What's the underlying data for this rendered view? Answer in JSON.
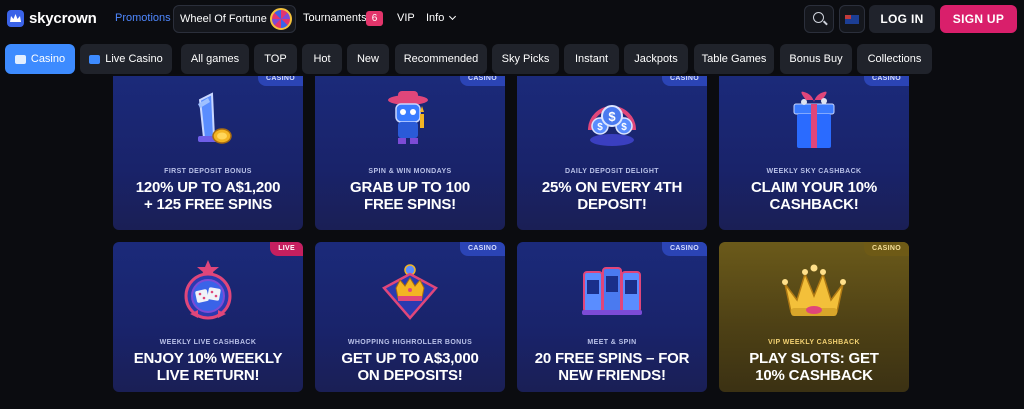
{
  "header": {
    "logo_text": "skycrown",
    "nav": {
      "promotions": "Promotions",
      "wheel_of_fortune": "Wheel Of Fortune",
      "tournaments": "Tournaments",
      "tournaments_count": "6",
      "vip": "VIP",
      "info": "Info"
    },
    "login_label": "LOG IN",
    "signup_label": "SIGN UP"
  },
  "categories": [
    {
      "label": "Casino",
      "active": true
    },
    {
      "label": "Live Casino"
    },
    {
      "label": "All games"
    },
    {
      "label": "TOP"
    },
    {
      "label": "Hot"
    },
    {
      "label": "New"
    },
    {
      "label": "Recommended"
    },
    {
      "label": "Sky Picks"
    },
    {
      "label": "Instant"
    },
    {
      "label": "Jackpots"
    },
    {
      "label": "Table Games"
    },
    {
      "label": "Bonus Buy"
    },
    {
      "label": "Collections"
    }
  ],
  "promos": [
    {
      "badge": "CASINO",
      "sub": "FIRST DEPOSIT BONUS",
      "head1": "120% UP TO A$1,200",
      "head2": "+ 125 FREE SPINS"
    },
    {
      "badge": "CASINO",
      "sub": "SPIN & WIN MONDAYS",
      "head1": "GRAB UP TO 100",
      "head2": "FREE SPINS!"
    },
    {
      "badge": "CASINO",
      "sub": "DAILY DEPOSIT DELIGHT",
      "head1": "25% ON EVERY 4TH",
      "head2": "DEPOSIT!"
    },
    {
      "badge": "CASINO",
      "sub": "WEEKLY SKY CASHBACK",
      "head1": "CLAIM YOUR 10%",
      "head2": "CASHBACK!"
    },
    {
      "badge": "LIVE",
      "sub": "WEEKLY LIVE CASHBACK",
      "head1": "ENJOY 10% WEEKLY",
      "head2": "LIVE RETURN!"
    },
    {
      "badge": "CASINO",
      "sub": "WHOPPING HIGHROLLER BONUS",
      "head1": "GET UP TO A$3,000",
      "head2": "ON DEPOSITS!"
    },
    {
      "badge": "CASINO",
      "sub": "MEET & SPIN",
      "head1": "20 FREE SPINS – FOR",
      "head2": "NEW FRIENDS!"
    },
    {
      "badge": "CASINO",
      "sub": "VIP WEEKLY CASHBACK",
      "head1": "PLAY SLOTS: GET",
      "head2": "10% CASHBACK"
    }
  ],
  "colors": {
    "accent_blue": "#3d8bff",
    "signup_pink": "#d91f6b",
    "card_navy": "#1b2a7a",
    "card_gold": "#6b5a1a"
  }
}
